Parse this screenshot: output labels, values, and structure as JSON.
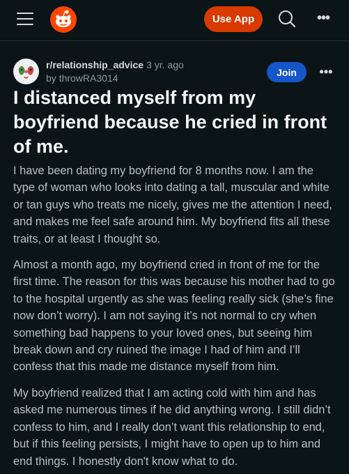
{
  "header": {
    "use_app_label": "Use App",
    "menu_icon": "hamburger-menu-icon",
    "logo_icon": "reddit-logo-icon",
    "search_icon": "search-icon",
    "more_icon": "ellipsis-icon"
  },
  "post": {
    "subreddit": "r/relationship_advice",
    "age": "3 yr. ago",
    "by_prefix": "by",
    "author": "throwRA3014",
    "join_label": "Join",
    "title": "I distanced myself from my boyfriend because he cried in front of me.",
    "paragraphs": [
      "I have been dating my boyfriend for 8 months now. I am the type of woman who looks into dating a tall, muscular and white or tan guys who treats me nicely, gives me the attention I need, and makes me feel safe around him. My boyfriend fits all these traits, or at least I thought so.",
      "Almost a month ago, my boyfriend cried in front of me for the first time. The reason for this was because his mother had to go to the hospital urgently as she was feeling really sick (she’s fine now don’t worry). I am not saying it’s not normal to cry when something bad happens to your loved ones, but seeing him break down and cry ruined the image I had of him and I’ll confess that this made me distance myself from him.",
      "My boyfriend realized that I am acting cold with him and has asked me numerous times if he did anything wrong. I still didn’t confess to him, and I really don’t want this relationship to end, but if this feeling persists, I might have to open up to him and end things. I honestly don't know what to do."
    ]
  },
  "colors": {
    "background": "#0b1416",
    "brand": "#ff4500",
    "use_app_bg": "#d93a00",
    "join_bg": "#1556c8"
  }
}
